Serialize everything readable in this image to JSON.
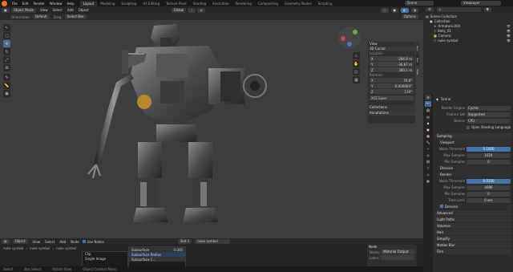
{
  "topbar": {
    "menus": [
      "File",
      "Edit",
      "Render",
      "Window",
      "Help"
    ],
    "tabs": [
      "Layout",
      "Modeling",
      "Sculpting",
      "UV Editing",
      "Texture Paint",
      "Shading",
      "Animation",
      "Rendering",
      "Compositing",
      "Geometry Nodes",
      "Scripting"
    ],
    "active_tab": "Layout",
    "scene_label": "Scene",
    "view_layer_label": "ViewLayer"
  },
  "viewport_header": {
    "mode": "Object Mode",
    "menus": [
      "View",
      "Select",
      "Add",
      "Object"
    ],
    "transform": "Global"
  },
  "tool_header": {
    "orientation_label": "Orientation:",
    "orientation": "Default",
    "drag_label": "Drag:",
    "drag": "Select Box",
    "options": "Options"
  },
  "npanel": {
    "view_label": "View",
    "cursor_label": "3D Cursor",
    "location_label": "Location",
    "location": [
      {
        "axis": "X",
        "value": "-286.8 m"
      },
      {
        "axis": "Y",
        "value": "-36.87 m"
      },
      {
        "axis": "Z",
        "value": "380.1 m"
      }
    ],
    "rotation_label": "Rotation",
    "rotation": [
      {
        "axis": "X",
        "value": "79.8°"
      },
      {
        "axis": "Y",
        "value": "-0.000094°"
      },
      {
        "axis": "Z",
        "value": "119°"
      }
    ],
    "rotation_mode": "XYZ Euler",
    "collections": "Collections",
    "annotations": "Annotations",
    "side_tabs": [
      "Item",
      "Tool",
      "View"
    ]
  },
  "outliner": {
    "title": "Scene Collection",
    "items": [
      {
        "name": "Collection",
        "icon": "collection-icon"
      },
      {
        "name": "Armature.004",
        "icon": "armature-icon"
      },
      {
        "name": "Belly_01",
        "icon": "mesh-icon"
      },
      {
        "name": "Camera",
        "icon": "camera-icon"
      },
      {
        "name": "nuke symbol",
        "icon": "mesh-icon"
      }
    ]
  },
  "properties": {
    "scene": "Scene",
    "render_engine_label": "Render Engine",
    "render_engine": "Cycles",
    "feature_set_label": "Feature Set",
    "feature_set": "Supported",
    "device_label": "Device",
    "device": "CPU",
    "osl_label": "Open Shading Language",
    "sampling": "Sampling",
    "viewport": "Viewport",
    "noise_threshold_label": "Noise Threshold",
    "vp_noise_threshold": "0.1000",
    "max_samples_label": "Max Samples",
    "vp_max_samples": "1024",
    "min_samples_label": "Min Samples",
    "vp_min_samples": "0",
    "denoise_label": "Denoise",
    "render": "Render",
    "r_noise_threshold": "0.0100",
    "r_max_samples": "4096",
    "r_min_samples": "0",
    "time_limit_label": "Time Limit",
    "time_limit": "0 sec",
    "advanced": "Advanced",
    "light_paths": "Light Paths",
    "volumes": "Volumes",
    "hair": "Hair",
    "simplify": "Simplify",
    "motion_blur": "Motion Blur",
    "film": "Film"
  },
  "node_editor": {
    "type": "Object",
    "menus": [
      "View",
      "Select",
      "Add",
      "Node"
    ],
    "use_nodes": "Use Nodes",
    "slot": "Slot 1",
    "material": "nuke symbol",
    "breadcrumb": [
      "nuke symbol",
      "nuke symbol",
      "nuke symbol"
    ],
    "menu_items": [
      "Clip",
      "Single Image"
    ],
    "dropdown": [
      {
        "name": "Subsurface",
        "value": "0.000"
      },
      {
        "name": "Subsurface Radius",
        "value": ""
      },
      {
        "name": "Subsurface C...",
        "value": ""
      }
    ],
    "node_panel_title": "Node",
    "name_label": "Name:",
    "name_value": "Material Output",
    "label_label": "Label:"
  },
  "status": {
    "items": [
      "Select",
      "Box Select",
      "Rotate View",
      "Object Context Menu"
    ]
  },
  "colors": {
    "accent": "#4672a8",
    "orange": "#e87d0d",
    "viewport": "#3d3d3d"
  }
}
